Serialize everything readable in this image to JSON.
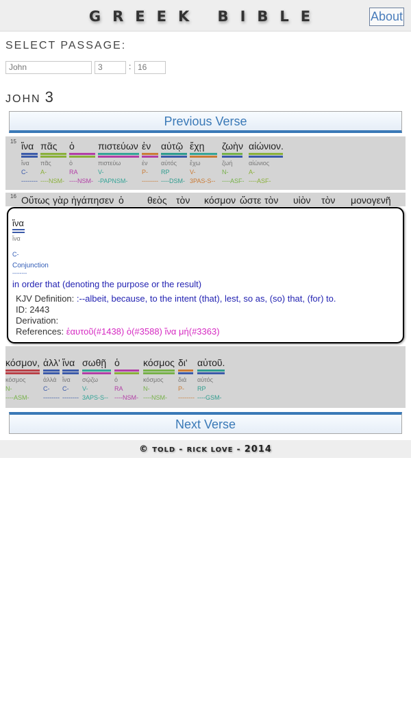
{
  "header": {
    "title": "GREEK BIBLE",
    "about_label": "About"
  },
  "select": {
    "label": "SELECT PASSAGE:",
    "book_value": "John",
    "chapter_value": "3",
    "separator": ":",
    "verse_value": "16"
  },
  "chapter": {
    "book": "JOHN",
    "number": "3"
  },
  "nav": {
    "previous_label": "Previous Verse",
    "next_label": "Next Verse"
  },
  "colors": {
    "conjunction": "#3b5aa9",
    "adjective": "#8ab03a",
    "article": "#b23ea6",
    "verb": "#35a497",
    "preposition": "#c97b36",
    "pronoun": "#2f9c8e",
    "noun": "#76b148",
    "adverb": "#b94047"
  },
  "verse15": {
    "number": "15",
    "words": [
      {
        "greek": "ἵνα",
        "lemma": "ἵνα",
        "pos": "C-",
        "parse": "--------",
        "color": "#3b5aa9",
        "color2": "#3b5aa9",
        "pos_color": "#3b5aa9"
      },
      {
        "greek": "πᾶς",
        "lemma": "πᾶς",
        "pos": "A-",
        "parse": "----NSM-",
        "color": "#8ab03a",
        "color2": "#8ab03a",
        "pos_color": "#8ab03a"
      },
      {
        "greek": "ὁ",
        "lemma": "ὁ",
        "pos": "RA",
        "parse": "----NSM-",
        "color": "#b23ea6",
        "color2": "#8ab03a",
        "pos_color": "#b23ea6"
      },
      {
        "greek": "πιστεύων",
        "lemma": "πιστεύω",
        "pos": "V-",
        "parse": "-PAPNSM-",
        "color": "#35a497",
        "color2": "#b23ea6",
        "pos_color": "#35a497"
      },
      {
        "greek": "ἐν",
        "lemma": "ἐν",
        "pos": "P-",
        "parse": "--------",
        "color": "#c97b36",
        "color2": "#b23ea6",
        "pos_color": "#c97b36"
      },
      {
        "greek": "αὐτῷ",
        "lemma": "αὐτός",
        "pos": "RP",
        "parse": "----DSM-",
        "color": "#2f9c8e",
        "color2": "#3b5aa9",
        "pos_color": "#2f9c8e"
      },
      {
        "greek": "ἔχῃ",
        "lemma": "ἔχω",
        "pos": "V-",
        "parse": "3PAS-S--",
        "color": "#35a497",
        "color2": "#c97b36",
        "pos_color": "#c97b36"
      },
      {
        "greek": "ζωὴν",
        "lemma": "ζωή",
        "pos": "N-",
        "parse": "----ASF-",
        "color": "#76b148",
        "color2": "#3b5aa9",
        "pos_color": "#76b148"
      },
      {
        "greek": "αἰώνιον.",
        "lemma": "αἰώνιος",
        "pos": "A-",
        "parse": "----ASF-",
        "color": "#8ab03a",
        "color2": "#3b5aa9",
        "pos_color": "#8ab03a"
      }
    ]
  },
  "verse16": {
    "number": "16",
    "words": [
      {
        "greek": "Οὕτως",
        "color": "#b94047"
      },
      {
        "greek": "γὰρ",
        "color": "#3b5aa9"
      },
      {
        "greek": "ἠγάπησεν",
        "color": "#35a497"
      },
      {
        "greek": "ὁ",
        "color": "#b23ea6"
      },
      {
        "greek": "θεὸς",
        "color": "#76b148"
      },
      {
        "greek": "τὸν",
        "color": "#b23ea6"
      },
      {
        "greek": "κόσμον",
        "color": "#76b148"
      },
      {
        "greek": "ὥστε",
        "color": "#3b5aa9"
      },
      {
        "greek": "τὸν",
        "color": "#b23ea6"
      },
      {
        "greek": "υἱὸν",
        "color": "#76b148"
      },
      {
        "greek": "τὸν",
        "color": "#b23ea6"
      },
      {
        "greek": "μονογενῆ",
        "color": "#8ab03a"
      }
    ],
    "words_end": [
      {
        "greek": "κόσμον,",
        "lemma": "κόσμος",
        "pos": "N-",
        "parse": "----ASM-",
        "color": "#b94047",
        "color2": "#b94047",
        "pos_color": "#76b148"
      },
      {
        "greek": "ἀλλ'",
        "lemma": "ἀλλά",
        "pos": "C-",
        "parse": "--------",
        "color": "#3b5aa9",
        "color2": "#3b5aa9",
        "pos_color": "#3b5aa9"
      },
      {
        "greek": "ἵνα",
        "lemma": "ἵνα",
        "pos": "C-",
        "parse": "--------",
        "color": "#3b5aa9",
        "color2": "#3b5aa9",
        "pos_color": "#3b5aa9"
      },
      {
        "greek": "σωθῇ",
        "lemma": "σῴζω",
        "pos": "V-",
        "parse": "3APS-S--",
        "color": "#35a497",
        "color2": "#b23ea6",
        "pos_color": "#35a497"
      },
      {
        "greek": "ὁ",
        "lemma": "ὁ",
        "pos": "RA",
        "parse": "----NSM-",
        "color": "#b23ea6",
        "color2": "#8ab03a",
        "pos_color": "#b23ea6"
      },
      {
        "greek": "κόσμος",
        "lemma": "κόσμος",
        "pos": "N-",
        "parse": "----NSM-",
        "color": "#76b148",
        "color2": "#76b148",
        "pos_color": "#76b148"
      },
      {
        "greek": "δι'",
        "lemma": "διά",
        "pos": "P-",
        "parse": "--------",
        "color": "#c97b36",
        "color2": "#3b5aa9",
        "pos_color": "#c97b36"
      },
      {
        "greek": "αὐτοῦ.",
        "lemma": "αὐτός",
        "pos": "RP",
        "parse": "----GSM-",
        "color": "#2f9c8e",
        "color2": "#3b5aa9",
        "pos_color": "#2f9c8e"
      }
    ]
  },
  "popup": {
    "greek": "ἵνα",
    "lemma": "ἵνα",
    "pos": "C-",
    "class": "Conjunction",
    "dashes": "--------",
    "gloss": "in order that (denoting the purpose or the result)",
    "kjv_label": "KJV Definition:",
    "kjv_value": ":--albeit, because, to the intent (that), lest, so as, (so) that, (for) to.",
    "id_label": "ID:",
    "id_value": "2443",
    "derivation_label": "Derivation:",
    "references_label": "References:",
    "references_value": "ἑαυτοῦ(#1438) ὁ(#3588) ἵνα μή(#3363)"
  },
  "footer": {
    "copyright_symbol": "©",
    "prefix": "TOLD",
    "dash": "-",
    "author": "RICK LOVE",
    "year": "2014"
  }
}
